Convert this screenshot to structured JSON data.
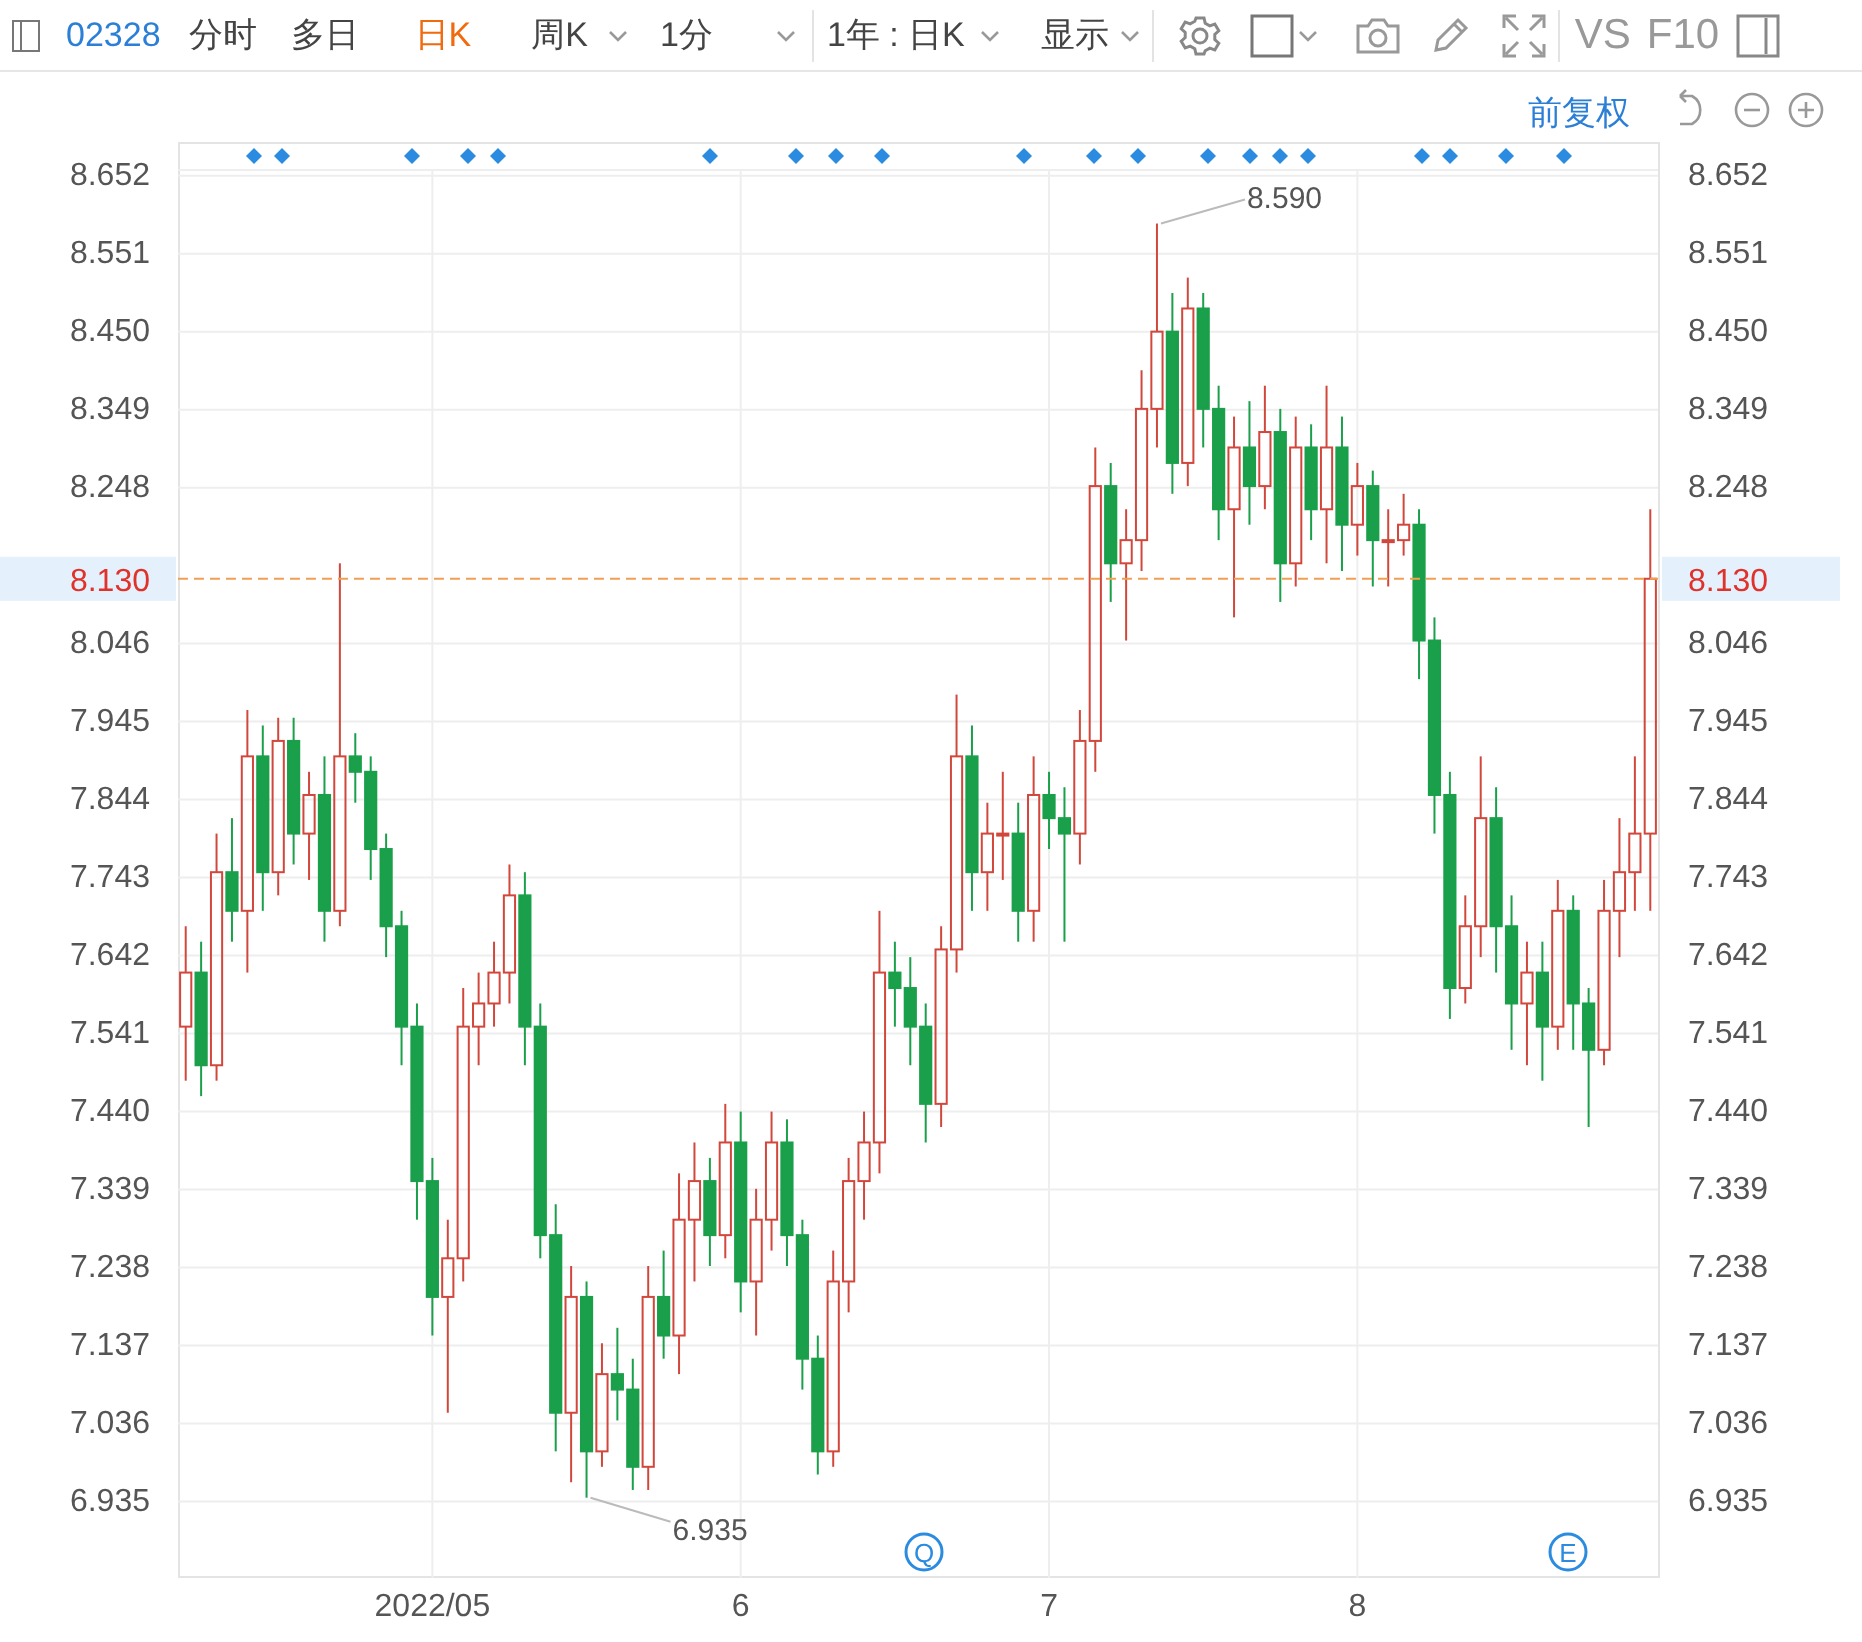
{
  "toolbar": {
    "stock_code": "02328",
    "period_tabs": [
      {
        "label": "分时",
        "selected": false,
        "dropdown": false
      },
      {
        "label": "多日",
        "selected": false,
        "dropdown": false
      },
      {
        "label": "日K",
        "selected": true,
        "dropdown": false
      },
      {
        "label": "周K",
        "selected": false,
        "dropdown": true
      },
      {
        "label": "1分",
        "selected": false,
        "dropdown": true
      }
    ],
    "range_select": "1年 : 日K",
    "display_menu": "显示",
    "text_buttons": [
      "VS",
      "F10"
    ]
  },
  "adjust_link": "前复权",
  "chart": {
    "right_axis_labels": [
      "8.652",
      "8.551",
      "8.450",
      "8.349",
      "8.248",
      "8.046",
      "7.945",
      "7.844",
      "7.743",
      "7.642",
      "7.541",
      "7.440",
      "7.339",
      "7.238",
      "7.137",
      "7.036",
      "6.935"
    ],
    "current_price": {
      "left_label": "8.130",
      "right_label": "8.130"
    },
    "high_annotation": "8.590",
    "low_annotation": "6.935",
    "event_markers": [
      {
        "label": "Q"
      },
      {
        "label": "E"
      }
    ],
    "chart_data": {
      "type": "candlestick",
      "grid": true,
      "ylim": [
        6.836,
        8.693
      ],
      "ref_lines": [
        {
          "axis": "y",
          "value": 8.13
        }
      ],
      "categories": [
        null,
        null,
        null,
        null,
        null,
        null,
        null,
        null,
        null,
        null,
        null,
        null,
        null,
        null,
        null,
        null,
        "2022/05",
        null,
        null,
        null,
        null,
        null,
        null,
        null,
        null,
        null,
        null,
        null,
        null,
        null,
        null,
        null,
        null,
        null,
        null,
        null,
        "6",
        null,
        null,
        null,
        null,
        null,
        null,
        null,
        null,
        null,
        null,
        null,
        null,
        null,
        null,
        null,
        null,
        null,
        null,
        null,
        "7",
        null,
        null,
        null,
        null,
        null,
        null,
        null,
        null,
        null,
        null,
        null,
        null,
        null,
        null,
        null,
        null,
        null,
        null,
        null,
        "8",
        null,
        null,
        null,
        null,
        null,
        null,
        null,
        null,
        null,
        null,
        null,
        null,
        null,
        null,
        null,
        null,
        null,
        null,
        null
      ],
      "yticks": [
        8.652,
        8.551,
        {
          "value": 8.45,
          "label": "8.450"
        },
        8.349,
        8.248,
        8.046,
        7.945,
        7.844,
        7.743,
        7.642,
        7.541,
        {
          "value": 7.44,
          "label": "7.440"
        },
        7.339,
        7.238,
        7.137,
        7.036,
        6.935
      ],
      "ohlc": [
        [
          7.55,
          7.68,
          7.48,
          7.62
        ],
        [
          7.62,
          7.66,
          7.46,
          7.5
        ],
        [
          7.5,
          7.8,
          7.48,
          7.75
        ],
        [
          7.75,
          7.82,
          7.66,
          7.7
        ],
        [
          7.7,
          7.96,
          7.62,
          7.9
        ],
        [
          7.9,
          7.94,
          7.7,
          7.75
        ],
        [
          7.75,
          7.95,
          7.72,
          7.92
        ],
        [
          7.92,
          7.95,
          7.76,
          7.8
        ],
        [
          7.8,
          7.88,
          7.74,
          7.85
        ],
        [
          7.85,
          7.9,
          7.66,
          7.7
        ],
        [
          7.7,
          8.15,
          7.68,
          7.9
        ],
        [
          7.9,
          7.93,
          7.84,
          7.88
        ],
        [
          7.88,
          7.9,
          7.74,
          7.78
        ],
        [
          7.78,
          7.8,
          7.64,
          7.68
        ],
        [
          7.68,
          7.7,
          7.5,
          7.55
        ],
        [
          7.55,
          7.58,
          7.3,
          7.35
        ],
        [
          7.35,
          7.38,
          7.15,
          7.2
        ],
        [
          7.2,
          7.3,
          7.05,
          7.25
        ],
        [
          7.25,
          7.6,
          7.22,
          7.55
        ],
        [
          7.55,
          7.62,
          7.5,
          7.58
        ],
        [
          7.58,
          7.66,
          7.55,
          7.62
        ],
        [
          7.62,
          7.76,
          7.58,
          7.72
        ],
        [
          7.72,
          7.75,
          7.5,
          7.55
        ],
        [
          7.55,
          7.58,
          7.25,
          7.28
        ],
        [
          7.28,
          7.32,
          7.0,
          7.05
        ],
        [
          7.05,
          7.24,
          6.96,
          7.2
        ],
        [
          7.2,
          7.22,
          6.94,
          7.0
        ],
        [
          7.0,
          7.14,
          6.98,
          7.1
        ],
        [
          7.1,
          7.16,
          7.04,
          7.08
        ],
        [
          7.08,
          7.12,
          6.95,
          6.98
        ],
        [
          6.98,
          7.24,
          6.95,
          7.2
        ],
        [
          7.2,
          7.26,
          7.12,
          7.15
        ],
        [
          7.15,
          7.36,
          7.1,
          7.3
        ],
        [
          7.3,
          7.4,
          7.22,
          7.35
        ],
        [
          7.35,
          7.38,
          7.24,
          7.28
        ],
        [
          7.28,
          7.45,
          7.25,
          7.4
        ],
        [
          7.4,
          7.44,
          7.18,
          7.22
        ],
        [
          7.22,
          7.34,
          7.15,
          7.3
        ],
        [
          7.3,
          7.44,
          7.26,
          7.4
        ],
        [
          7.4,
          7.43,
          7.24,
          7.28
        ],
        [
          7.28,
          7.3,
          7.08,
          7.12
        ],
        [
          7.12,
          7.15,
          6.97,
          7.0
        ],
        [
          7.0,
          7.26,
          6.98,
          7.22
        ],
        [
          7.22,
          7.38,
          7.18,
          7.35
        ],
        [
          7.35,
          7.44,
          7.3,
          7.4
        ],
        [
          7.4,
          7.7,
          7.36,
          7.62
        ],
        [
          7.62,
          7.66,
          7.55,
          7.6
        ],
        [
          7.6,
          7.64,
          7.5,
          7.55
        ],
        [
          7.55,
          7.58,
          7.4,
          7.45
        ],
        [
          7.45,
          7.68,
          7.42,
          7.65
        ],
        [
          7.65,
          7.98,
          7.62,
          7.9
        ],
        [
          7.9,
          7.94,
          7.7,
          7.75
        ],
        [
          7.75,
          7.84,
          7.7,
          7.8
        ],
        [
          7.8,
          7.88,
          7.74,
          7.8
        ],
        [
          7.8,
          7.84,
          7.66,
          7.7
        ],
        [
          7.7,
          7.9,
          7.66,
          7.85
        ],
        [
          7.85,
          7.88,
          7.78,
          7.82
        ],
        [
          7.82,
          7.86,
          7.66,
          7.8
        ],
        [
          7.8,
          7.96,
          7.76,
          7.92
        ],
        [
          7.92,
          8.3,
          7.88,
          8.25
        ],
        [
          8.25,
          8.28,
          8.1,
          8.15
        ],
        [
          8.15,
          8.22,
          8.05,
          8.18
        ],
        [
          8.18,
          8.4,
          8.14,
          8.35
        ],
        [
          8.35,
          8.59,
          8.3,
          8.45
        ],
        [
          8.45,
          8.5,
          8.24,
          8.28
        ],
        [
          8.28,
          8.52,
          8.25,
          8.48
        ],
        [
          8.48,
          8.5,
          8.3,
          8.35
        ],
        [
          8.35,
          8.38,
          8.18,
          8.22
        ],
        [
          8.22,
          8.34,
          8.08,
          8.3
        ],
        [
          8.3,
          8.36,
          8.2,
          8.25
        ],
        [
          8.25,
          8.38,
          8.22,
          8.32
        ],
        [
          8.32,
          8.35,
          8.1,
          8.15
        ],
        [
          8.15,
          8.34,
          8.12,
          8.3
        ],
        [
          8.3,
          8.33,
          8.18,
          8.22
        ],
        [
          8.22,
          8.38,
          8.15,
          8.3
        ],
        [
          8.3,
          8.34,
          8.14,
          8.2
        ],
        [
          8.2,
          8.28,
          8.16,
          8.25
        ],
        [
          8.25,
          8.27,
          8.12,
          8.18
        ],
        [
          8.18,
          8.22,
          8.12,
          8.18
        ],
        [
          8.18,
          8.24,
          8.16,
          8.2
        ],
        [
          8.2,
          8.22,
          8.0,
          8.05
        ],
        [
          8.05,
          8.08,
          7.8,
          7.85
        ],
        [
          7.85,
          7.88,
          7.56,
          7.6
        ],
        [
          7.6,
          7.72,
          7.58,
          7.68
        ],
        [
          7.68,
          7.9,
          7.64,
          7.82
        ],
        [
          7.82,
          7.86,
          7.62,
          7.68
        ],
        [
          7.68,
          7.72,
          7.52,
          7.58
        ],
        [
          7.58,
          7.66,
          7.5,
          7.62
        ],
        [
          7.62,
          7.66,
          7.48,
          7.55
        ],
        [
          7.55,
          7.74,
          7.52,
          7.7
        ],
        [
          7.7,
          7.72,
          7.52,
          7.58
        ],
        [
          7.58,
          7.6,
          7.42,
          7.52
        ],
        [
          7.52,
          7.74,
          7.5,
          7.7
        ],
        [
          7.7,
          7.82,
          7.64,
          7.75
        ],
        [
          7.75,
          7.9,
          7.7,
          7.8
        ],
        [
          7.8,
          8.22,
          7.7,
          8.13
        ]
      ]
    }
  }
}
